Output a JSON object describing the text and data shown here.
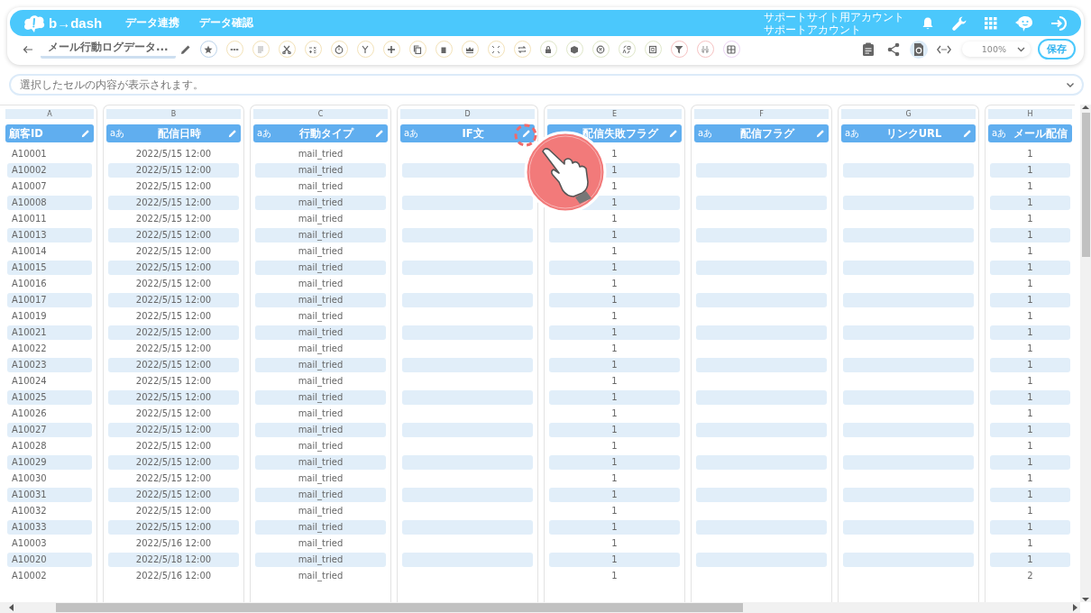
{
  "header": {
    "logo": "b→dash",
    "nav": [
      {
        "label": "データ連携"
      },
      {
        "label": "データ確認"
      }
    ],
    "account": {
      "site": "サポートサイト用アカウント",
      "name": "サポートアカウント"
    }
  },
  "toolbar": {
    "title": "メール行動ログデータ...",
    "zoom": "100%",
    "save": "保存"
  },
  "formula_bar": {
    "placeholder": "選択したセルの内容が表示されます。"
  },
  "sheet": {
    "columns": [
      {
        "letter": "A",
        "title": "顧客ID"
      },
      {
        "letter": "B",
        "title": "配信日時",
        "badge": "aあ"
      },
      {
        "letter": "C",
        "title": "行動タイプ",
        "badge": "aあ"
      },
      {
        "letter": "D",
        "title": "IF文",
        "badge": "aあ"
      },
      {
        "letter": "E",
        "title": "配信失敗フラグ"
      },
      {
        "letter": "F",
        "title": "配信フラグ",
        "badge": "aあ"
      },
      {
        "letter": "G",
        "title": "リンクURL",
        "badge": "aあ"
      },
      {
        "letter": "H",
        "title": "メール配信",
        "badge": "aあ"
      }
    ],
    "rows": [
      {
        "A": "A10001",
        "B": "2022/5/15 12:00",
        "C": "mail_tried",
        "E": "1",
        "H": "1"
      },
      {
        "A": "A10002",
        "B": "2022/5/15 12:00",
        "C": "mail_tried",
        "E": "1",
        "H": "1"
      },
      {
        "A": "A10007",
        "B": "2022/5/15 12:00",
        "C": "mail_tried",
        "E": "1",
        "H": "1"
      },
      {
        "A": "A10008",
        "B": "2022/5/15 12:00",
        "C": "mail_tried",
        "E": "1",
        "H": "1"
      },
      {
        "A": "A10011",
        "B": "2022/5/15 12:00",
        "C": "mail_tried",
        "E": "1",
        "H": "1"
      },
      {
        "A": "A10013",
        "B": "2022/5/15 12:00",
        "C": "mail_tried",
        "E": "1",
        "H": "1"
      },
      {
        "A": "A10014",
        "B": "2022/5/15 12:00",
        "C": "mail_tried",
        "E": "1",
        "H": "1"
      },
      {
        "A": "A10015",
        "B": "2022/5/15 12:00",
        "C": "mail_tried",
        "E": "1",
        "H": "1"
      },
      {
        "A": "A10016",
        "B": "2022/5/15 12:00",
        "C": "mail_tried",
        "E": "1",
        "H": "1"
      },
      {
        "A": "A10017",
        "B": "2022/5/15 12:00",
        "C": "mail_tried",
        "E": "1",
        "H": "1"
      },
      {
        "A": "A10019",
        "B": "2022/5/15 12:00",
        "C": "mail_tried",
        "E": "1",
        "H": "1"
      },
      {
        "A": "A10021",
        "B": "2022/5/15 12:00",
        "C": "mail_tried",
        "E": "1",
        "H": "1"
      },
      {
        "A": "A10022",
        "B": "2022/5/15 12:00",
        "C": "mail_tried",
        "E": "1",
        "H": "1"
      },
      {
        "A": "A10023",
        "B": "2022/5/15 12:00",
        "C": "mail_tried",
        "E": "1",
        "H": "1"
      },
      {
        "A": "A10024",
        "B": "2022/5/15 12:00",
        "C": "mail_tried",
        "E": "1",
        "H": "1"
      },
      {
        "A": "A10025",
        "B": "2022/5/15 12:00",
        "C": "mail_tried",
        "E": "1",
        "H": "1"
      },
      {
        "A": "A10026",
        "B": "2022/5/15 12:00",
        "C": "mail_tried",
        "E": "1",
        "H": "1"
      },
      {
        "A": "A10027",
        "B": "2022/5/15 12:00",
        "C": "mail_tried",
        "E": "1",
        "H": "1"
      },
      {
        "A": "A10028",
        "B": "2022/5/15 12:00",
        "C": "mail_tried",
        "E": "1",
        "H": "1"
      },
      {
        "A": "A10029",
        "B": "2022/5/15 12:00",
        "C": "mail_tried",
        "E": "1",
        "H": "1"
      },
      {
        "A": "A10030",
        "B": "2022/5/15 12:00",
        "C": "mail_tried",
        "E": "1",
        "H": "1"
      },
      {
        "A": "A10031",
        "B": "2022/5/15 12:00",
        "C": "mail_tried",
        "E": "1",
        "H": "1"
      },
      {
        "A": "A10032",
        "B": "2022/5/15 12:00",
        "C": "mail_tried",
        "E": "1",
        "H": "1"
      },
      {
        "A": "A10033",
        "B": "2022/5/15 12:00",
        "C": "mail_tried",
        "E": "1",
        "H": "1"
      },
      {
        "A": "A10003",
        "B": "2022/5/16 12:00",
        "C": "mail_tried",
        "E": "1",
        "H": "1"
      },
      {
        "A": "A10020",
        "B": "2022/5/18 12:00",
        "C": "mail_tried",
        "E": "1",
        "H": "1"
      },
      {
        "A": "A10002",
        "B": "2022/5/16 12:00",
        "C": "mail_tried",
        "E": "1",
        "H": "2"
      }
    ]
  }
}
